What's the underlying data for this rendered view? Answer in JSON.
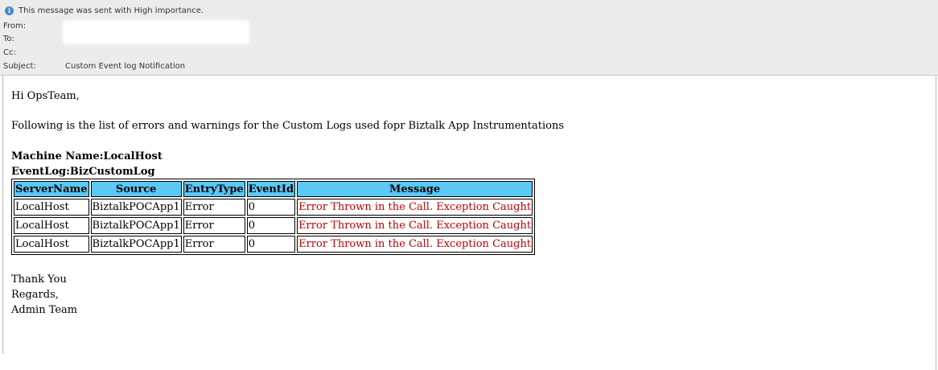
{
  "header": {
    "importance_notice": "This message was sent with High importance.",
    "from_label": "From:",
    "to_label": "To:",
    "cc_label": "Cc:",
    "subject_label": "Subject:",
    "subject_value": "Custom Event log Notification",
    "info_icon": "info-icon"
  },
  "body": {
    "greeting": "Hi OpsTeam,",
    "intro": "Following is the list of errors and warnings for the Custom Logs used fopr Biztalk App Instrumentations",
    "machine_name": "Machine Name:LocalHost",
    "event_log": "EventLog:BizCustomLog",
    "thanks": "Thank You",
    "regards": "Regards,",
    "signature": "Admin Team"
  },
  "table": {
    "columns": [
      "ServerName",
      "Source",
      "EntryType",
      "EventId",
      "Message"
    ],
    "rows": [
      [
        "LocalHost",
        "BiztalkPOCApp1",
        "Error",
        "0",
        "Error Thrown in the Call. Exception Caught"
      ],
      [
        "LocalHost",
        "BiztalkPOCApp1",
        "Error",
        "0",
        "Error Thrown in the Call. Exception Caught"
      ],
      [
        "LocalHost",
        "BiztalkPOCApp1",
        "Error",
        "0",
        "Error Thrown in the Call. Exception Caught"
      ]
    ],
    "header_color": "#5bc8f5",
    "message_color": "#c00000"
  }
}
